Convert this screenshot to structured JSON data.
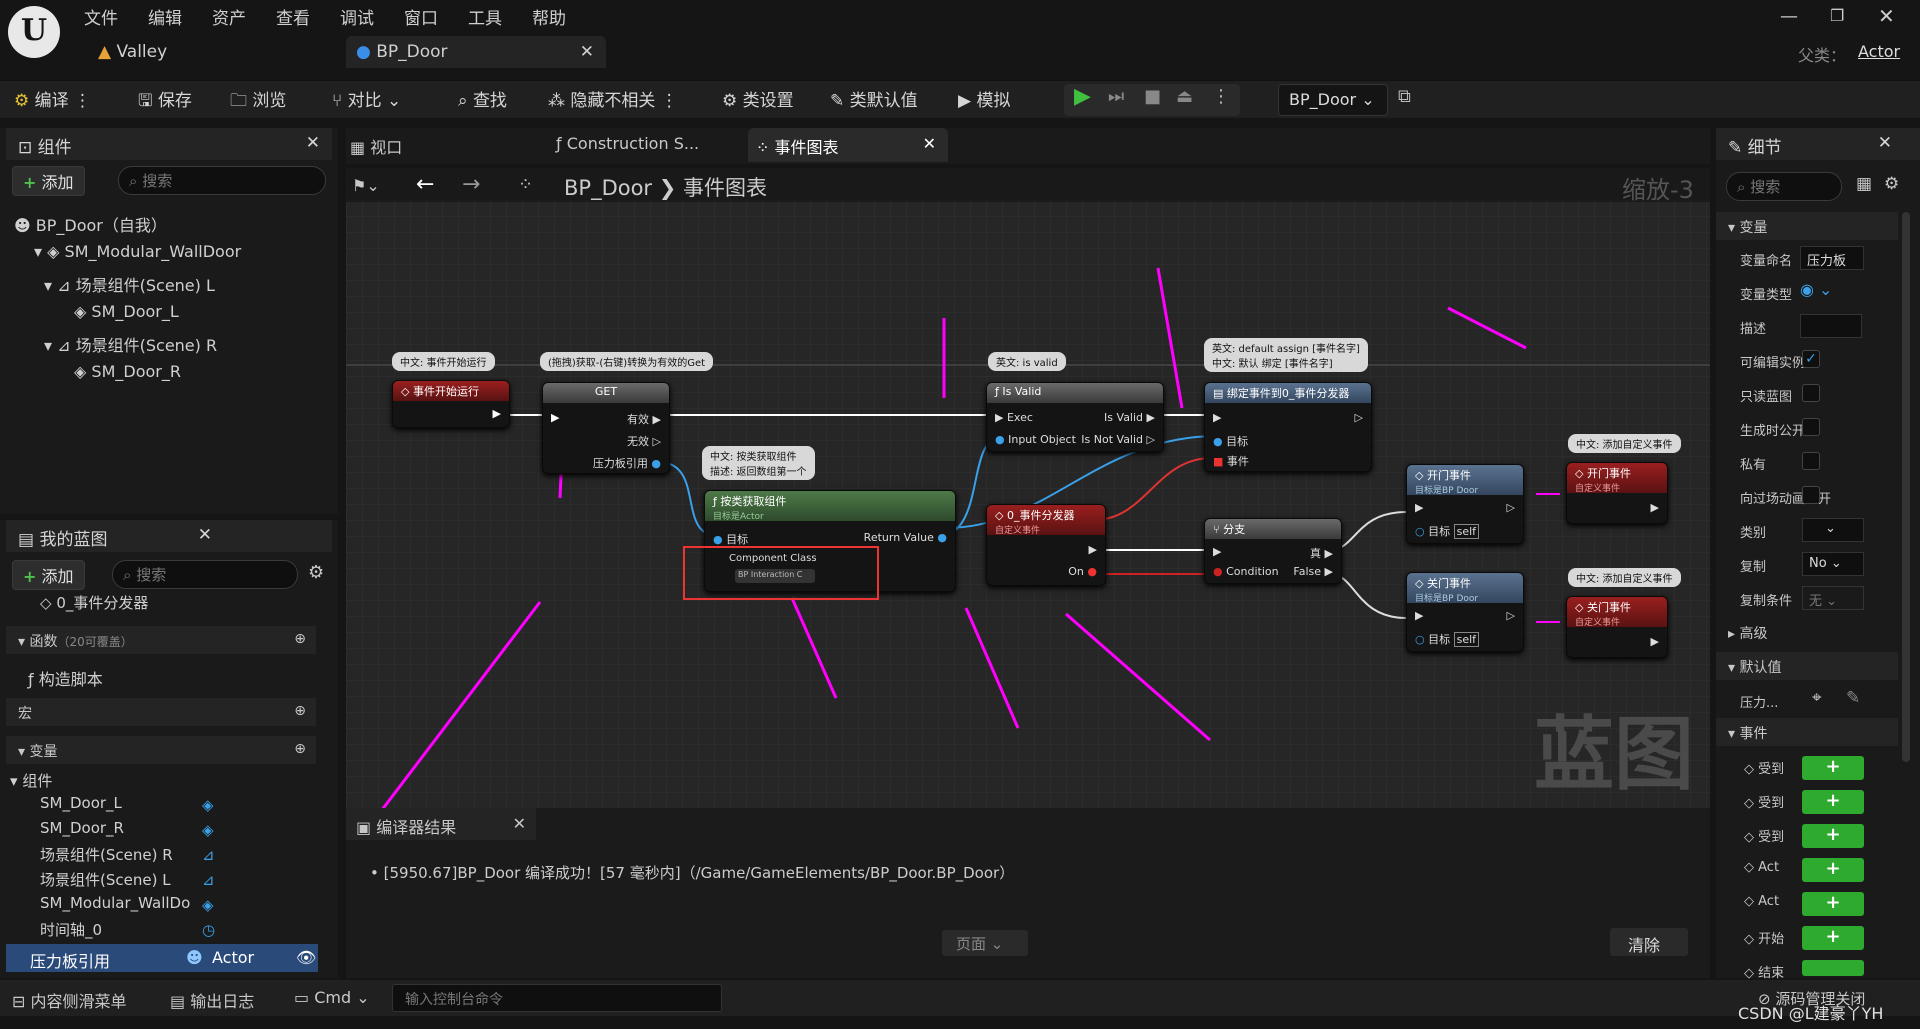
{
  "menu": {
    "items": [
      "文件",
      "编辑",
      "资产",
      "查看",
      "调试",
      "窗口",
      "工具",
      "帮助"
    ]
  },
  "tabs": [
    {
      "label": "Valley"
    },
    {
      "label": "BP_Door"
    }
  ],
  "parent_class": {
    "label": "父类：",
    "value": "Actor"
  },
  "toolbar": {
    "compile": "编译",
    "save": "保存",
    "browse": "浏览",
    "diff": "对比",
    "find": "查找",
    "hide_unrelated": "隐藏不相关",
    "class_settings": "类设置",
    "class_defaults": "类默认值",
    "simulate": "模拟",
    "debug_object": "BP_Door"
  },
  "components_panel": {
    "title": "组件",
    "add": "添加",
    "search_placeholder": "搜索",
    "items": [
      "BP_Door（自我）",
      "SM_Modular_WallDoor",
      "场景组件(Scene) L",
      "SM_Door_L",
      "场景组件(Scene) R",
      "SM_Door_R"
    ]
  },
  "mybp_panel": {
    "title": "我的蓝图",
    "add": "添加",
    "search_placeholder": "搜索",
    "partial_item": "0_事件分发器",
    "functions": {
      "label": "函数",
      "hint": "（20可覆盖）"
    },
    "construct": "构造脚本",
    "macros": "宏",
    "variables": "变量",
    "components_group": "组件",
    "var_items": [
      "SM_Door_L",
      "SM_Door_R",
      "场景组件(Scene) R",
      "场景组件(Scene) L",
      "SM_Modular_WallDo",
      "时间轴_0"
    ],
    "selected": {
      "name": "压力板引用",
      "type": "Actor"
    }
  },
  "viewtabs": [
    {
      "label": "视口"
    },
    {
      "label": "Construction S..."
    },
    {
      "label": "事件图表"
    }
  ],
  "graph": {
    "breadcrumb": [
      "BP_Door",
      "事件图表"
    ],
    "zoom": "缩放-3",
    "watermark": "蓝图",
    "comments": [
      "中文: 事件开始运行",
      "(拖拽)获取-(右键)转换为有效的Get",
      "中文: 按类获取组件\n描述: 返回数组第一个",
      "英文: is valid",
      "英文: default assign [事件名字]\n中文: 默认 绑定 [事件名字]",
      "中文: 添加自定义事件",
      "中文: 添加自定义事件"
    ],
    "nodes": {
      "begin": {
        "title": "事件开始运行"
      },
      "get": {
        "title": "GET",
        "valid": "有效",
        "invalid": "无效",
        "ref": "压力板引用"
      },
      "getcomp": {
        "title": "按类获取组件",
        "sub": "目标是Actor",
        "target": "目标",
        "ret": "Return Value",
        "cls_label": "Component Class",
        "cls_value": "BP Interaction C"
      },
      "isvalid": {
        "title": "Is Valid",
        "exec": "Exec",
        "input": "Input Object",
        "valid": "Is Valid",
        "notvalid": "Is Not Valid"
      },
      "bind": {
        "title": "绑定事件到0_事件分发器",
        "target": "目标",
        "event": "事件"
      },
      "dispatcher": {
        "title": "0_事件分发器",
        "sub": "自定义事件",
        "on": "On"
      },
      "branch": {
        "title": "分支",
        "cond": "Condition",
        "true": "真",
        "false": "False"
      },
      "open_call": {
        "title": "开门事件",
        "sub": "目标是BP Door",
        "target": "目标",
        "self": "self"
      },
      "close_call": {
        "title": "关门事件",
        "sub": "目标是BP Door",
        "target": "目标",
        "self": "self"
      },
      "open_evt": {
        "title": "开门事件",
        "sub": "自定义事件"
      },
      "close_evt": {
        "title": "关门事件",
        "sub": "自定义事件"
      }
    }
  },
  "compiler": {
    "title": "编译器结果",
    "message": "[5950.67]BP_Door 编译成功！[57 毫秒内]（/Game/GameElements/BP_Door.BP_Door）",
    "page": "页面",
    "clear": "清除"
  },
  "details": {
    "title": "细节",
    "search_placeholder": "搜索",
    "variable_section": "变量",
    "rows": [
      {
        "label": "变量命名",
        "value": "压力板"
      },
      {
        "label": "变量类型",
        "value": ""
      },
      {
        "label": "描述",
        "value": ""
      },
      {
        "label": "可编辑实例",
        "value": "checked"
      },
      {
        "label": "只读蓝图",
        "value": ""
      },
      {
        "label": "生成时公开",
        "value": ""
      },
      {
        "label": "私有",
        "value": ""
      },
      {
        "label": "向过场动画公开",
        "value": ""
      },
      {
        "label": "类别",
        "value": ""
      },
      {
        "label": "复制",
        "value": "No"
      },
      {
        "label": "复制条件",
        "value": "无"
      }
    ],
    "advanced": "高级",
    "default_section": "默认值",
    "default_row": "压力...",
    "events_section": "事件",
    "events": [
      "受到",
      "受到",
      "受到",
      "Act",
      "Act",
      "开始",
      "结束"
    ]
  },
  "statusbar": {
    "drawer": "内容侧滑菜单",
    "log": "输出日志",
    "cmd": "Cmd",
    "console_placeholder": "输入控制台命令",
    "source": "源码管理关闭"
  },
  "watermark": "CSDN @L建豪丫YH"
}
